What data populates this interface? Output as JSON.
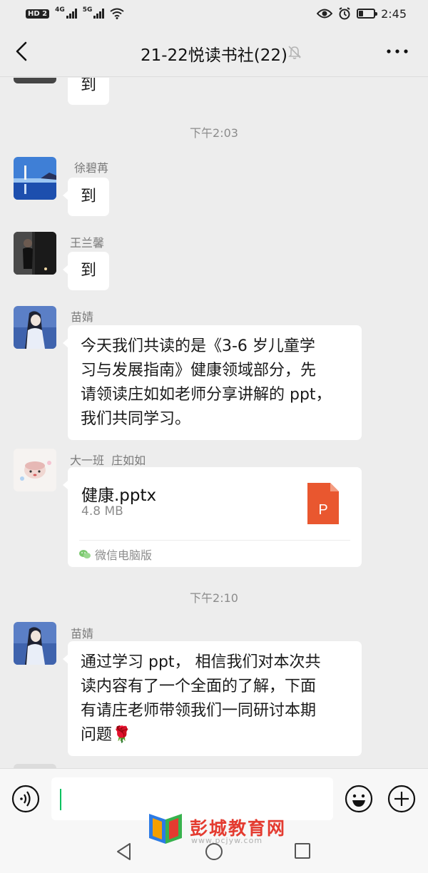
{
  "status_bar": {
    "hd_badge": "HD",
    "hd_sub": "2",
    "net1": "4G",
    "net2": "5G",
    "time": "2:45",
    "battery_level": 0.3
  },
  "header": {
    "title": "21-22悦读书社(22)",
    "muted": true
  },
  "chat": {
    "top_partial_message": "到",
    "timestamps": [
      "下午2:03",
      "下午2:10"
    ],
    "messages": [
      {
        "sender": "徐碧苒",
        "text": "到"
      },
      {
        "sender": "王兰馨",
        "text": "到"
      },
      {
        "sender": "苗婧",
        "lines": [
          "今天我们共读的是《3-6 岁儿童学",
          "习与发展指南》健康领域部分，先",
          "请领读庄如如老师分享讲解的 ppt，",
          "我们共同学习。"
        ]
      },
      {
        "sender": "大一班  庄如如",
        "file": {
          "name": "健康.pptx",
          "size": "4.8 MB",
          "icon_letter": "P",
          "source": "微信电脑版"
        }
      },
      {
        "sender": "苗婧",
        "lines": [
          "通过学习 ppt， 相信我们对本次共",
          "读内容有了一个全面的了解，下面",
          "有请庄老师带领我们一同研讨本期",
          "问题🌹"
        ]
      }
    ]
  },
  "input": {
    "value": ""
  },
  "watermark": {
    "text": "彭城教育网",
    "url": "www.pcjyw.com"
  },
  "colors": {
    "background": "#ededed",
    "bubble": "#ffffff",
    "pptx_orange": "#e9572f",
    "wechat_green": "#07c160",
    "watermark_red": "#e43b30"
  },
  "icons": [
    "back-arrow-icon",
    "mute-bell-icon",
    "more-icon",
    "voice-icon",
    "emoji-icon",
    "plus-icon",
    "pptx-file-icon",
    "wechat-pc-icon"
  ]
}
